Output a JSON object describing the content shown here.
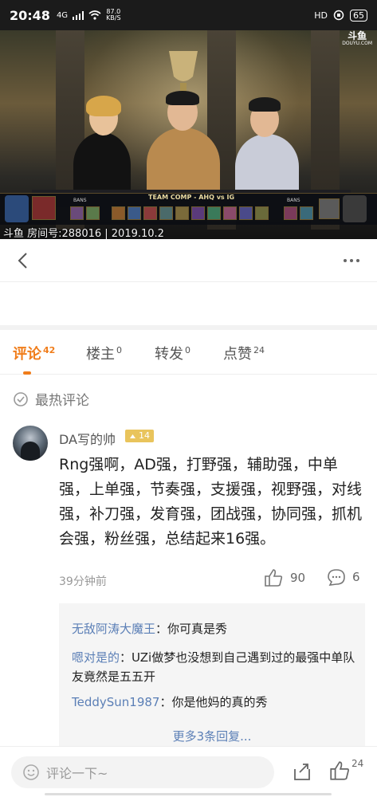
{
  "status_bar": {
    "time": "20:48",
    "network": "4G",
    "speed_value": "87.0",
    "speed_unit": "KB/S",
    "hd_label": "HD",
    "battery": "65"
  },
  "video": {
    "watermark": "斗鱼",
    "watermark_sub": "DOUYU.COM",
    "teamcomp_title": "TEAM COMP - AHQ vs IG",
    "bans_left": "BANS",
    "bans_right": "BANS",
    "caption": "斗鱼 房间号:288016 | 2019.10.2"
  },
  "tabs": [
    {
      "label": "评论",
      "count": "42"
    },
    {
      "label": "楼主",
      "count": "0"
    },
    {
      "label": "转发",
      "count": "0"
    },
    {
      "label": "点赞",
      "count": "24"
    }
  ],
  "hot_label": "最热评论",
  "comment": {
    "username": "DA写的帅",
    "level": "14",
    "text": "Rng强啊，AD强，打野强，辅助强，中单强，上单强，节奏强，支援强，视野强，对线强，补刀强，发育强，团战强，协同强，抓机会强，粉丝强，总结起来16强。",
    "time": "39分钟前",
    "likes": "90",
    "replies_count": "6"
  },
  "replies": [
    {
      "user": "无敌阿涛大魔王",
      "text": "你可真是秀"
    },
    {
      "user": "嗯对是的",
      "text": "UZi做梦也没想到自己遇到过的最强中单队友竟然是五五开"
    },
    {
      "user": "TeddySun1987",
      "text": "你是他妈的真的秀"
    }
  ],
  "more_replies": "更多3条回复...",
  "bottom": {
    "input_placeholder": "评论一下~",
    "like_count": "24"
  }
}
